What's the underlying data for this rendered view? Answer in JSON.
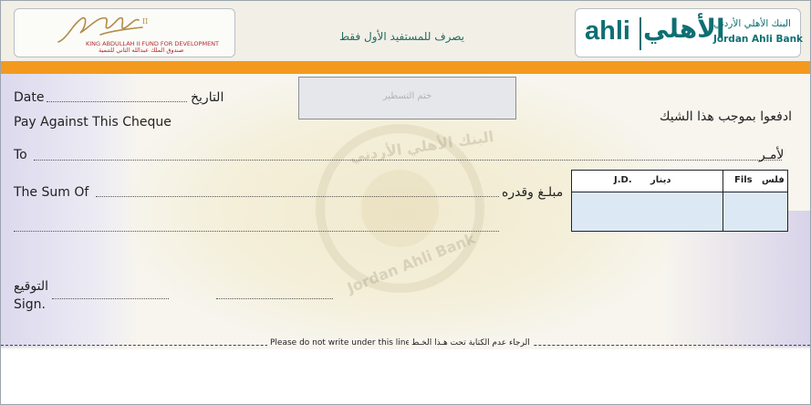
{
  "header": {
    "fund_en": "KING ABDULLAH II FUND FOR DEVELOPMENT",
    "fund_ar": "صندوق الملك عبدالله الثاني للتنمية",
    "payee_only_ar": "يصرف للمستفيد الأول فقط",
    "bank_latin": "ahli",
    "bank_arabic": "الأهلي",
    "bank_name_ar": "البنك الأهلي الأردني",
    "bank_name_en": "Jordan Ahli Bank"
  },
  "stamp": {
    "label": "ختم التسطير"
  },
  "fields": {
    "date_en": "Date",
    "date_ar": "التاريخ",
    "pay_en": "Pay Against This Cheque",
    "pay_ar": "ادفعوا بموجب هذا الشيك",
    "to_en": "To",
    "to_ar": "لأمـر",
    "sum_en": "The Sum Of",
    "sum_ar": "مبلـغ وقدره",
    "sign_ar": "التوقيع",
    "sign_en": "Sign."
  },
  "amount_box": {
    "jd_en": "J.D.",
    "jd_ar": "دينار",
    "fils_en": "Fils",
    "fils_ar": "فلس"
  },
  "watermark": {
    "ar": "البنك الأهلي الأردني",
    "en": "Jordan Ahli Bank"
  },
  "footer": {
    "no_write_en": "Please do not write under this line",
    "no_write_ar": "الرجاء عدم الكتابة تحت هـذا الخـط"
  },
  "colors": {
    "accent_orange": "#f39a1e",
    "bank_teal": "#0e6f73",
    "fund_red": "#b7282e"
  }
}
